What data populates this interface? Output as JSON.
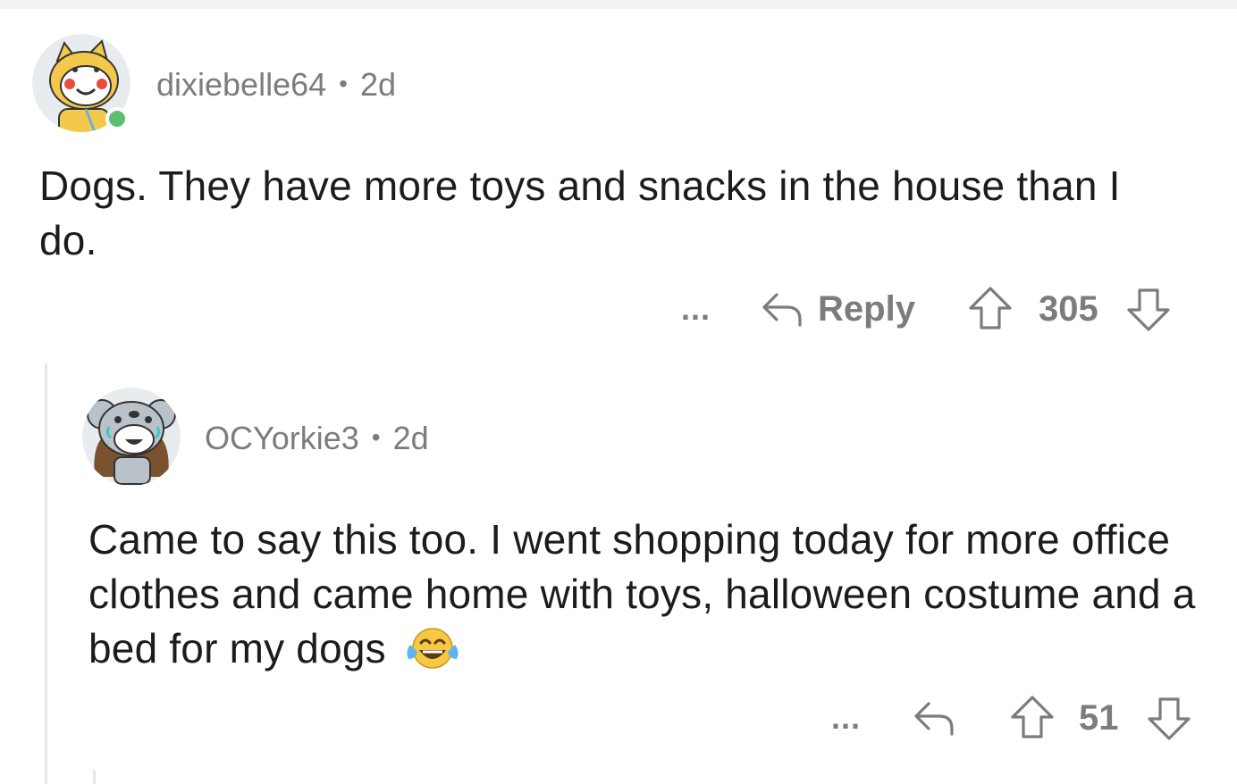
{
  "comments": [
    {
      "username": "dixiebelle64",
      "separator": "•",
      "age": "2d",
      "body": "Dogs. They have more toys and snacks in the house than I do.",
      "more_label": "...",
      "reply_label": "Reply",
      "score": "305",
      "online": true,
      "icons": [
        "avatar-snoo-icon",
        "reply-arrow-icon",
        "upvote-icon",
        "downvote-icon"
      ]
    },
    {
      "username": "OCYorkie3",
      "separator": "•",
      "age": "2d",
      "body": "Came to say this too. I went shopping today for more office clothes and came home with toys, halloween costume and a bed for my dogs",
      "emoji": "face-with-tears-of-joy",
      "more_label": "...",
      "score": "51",
      "icons": [
        "avatar-snoo-icon",
        "reply-arrow-icon",
        "upvote-icon",
        "downvote-icon"
      ]
    }
  ],
  "colors": {
    "meta_text": "#7c7c7c",
    "body_text": "#1c1c1c",
    "online": "#5cbf6d",
    "thread_line": "#e6e7e9"
  }
}
